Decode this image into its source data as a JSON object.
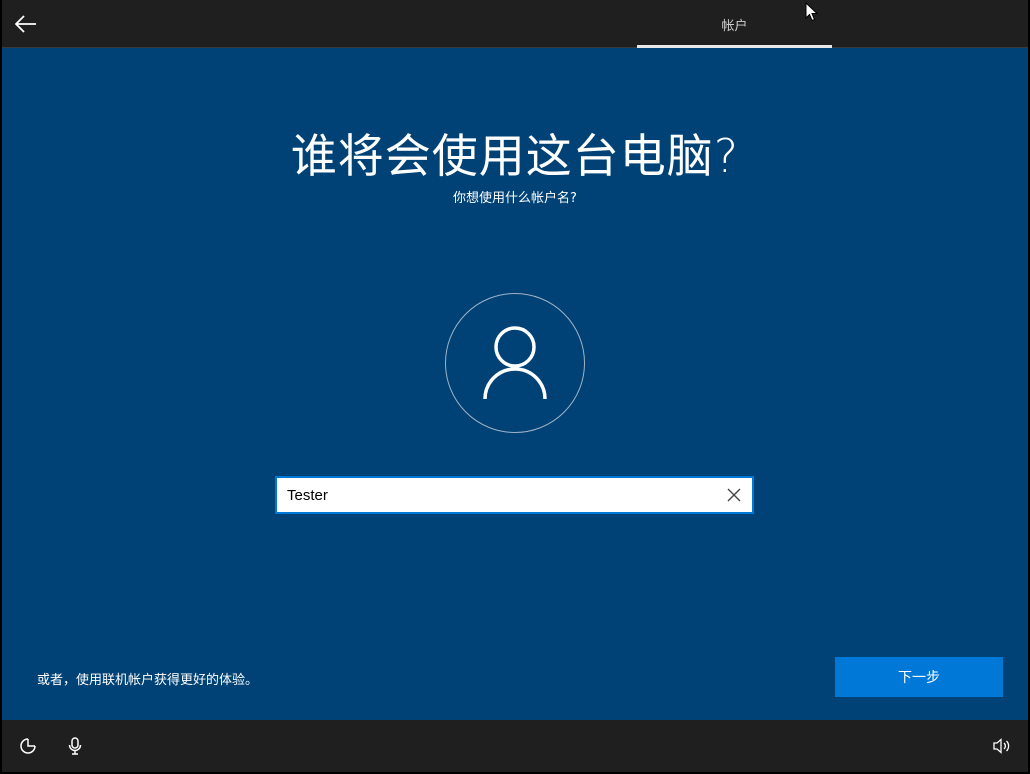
{
  "topbar": {
    "tab_label": "帐户"
  },
  "main": {
    "title": "谁将会使用这台电脑?",
    "subtitle": "你想使用什么帐户名?",
    "username_value": "Tester",
    "online_account_link": "或者，使用联机帐户获得更好的体验。",
    "next_label": "下一步"
  },
  "icons": {
    "back": "back-arrow-icon",
    "avatar": "user-icon",
    "clear": "clear-x-icon",
    "accessibility": "accessibility-icon",
    "microphone": "microphone-icon",
    "volume": "volume-icon"
  },
  "colors": {
    "background": "#004275",
    "accent": "#0078d7",
    "bar": "#1f1f1f"
  }
}
